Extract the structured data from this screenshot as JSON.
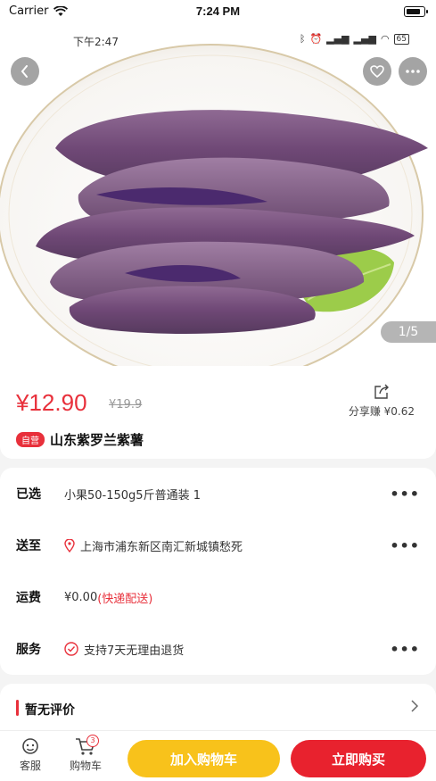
{
  "status_bar": {
    "carrier": "Carrier",
    "time": "7:24 PM"
  },
  "hero": {
    "inner_time": "下午2:47",
    "inner_battery": "65",
    "image_counter": "1/5",
    "back_icon": "chevron-left-icon",
    "favorite_icon": "heart-icon",
    "more_icon": "more-dots-icon"
  },
  "product": {
    "price": "¥12.90",
    "original_price": "¥19.9",
    "share_label": "分享赚 ¥0.62",
    "self_tag": "自营",
    "title": "山东紫罗兰紫薯"
  },
  "options": [
    {
      "label": "已选",
      "value": "小果50-150g5斤普通装 1"
    },
    {
      "label": "送至",
      "value": "上海市浦东新区南汇新城镇愁死"
    },
    {
      "label": "运费",
      "value": "¥0.00",
      "value_extra": "(快递配送)"
    },
    {
      "label": "服务",
      "value": "支持7天无理由退货"
    }
  ],
  "reviews": {
    "title": "暂无评价"
  },
  "bottom_bar": {
    "service_label": "客服",
    "cart_label": "购物车",
    "cart_count": "3",
    "add_to_cart": "加入购物车",
    "buy_now": "立即购买"
  },
  "colors": {
    "accent": "#e8303b",
    "cart_button": "#f8c21b",
    "buy_button": "#e8222e"
  }
}
